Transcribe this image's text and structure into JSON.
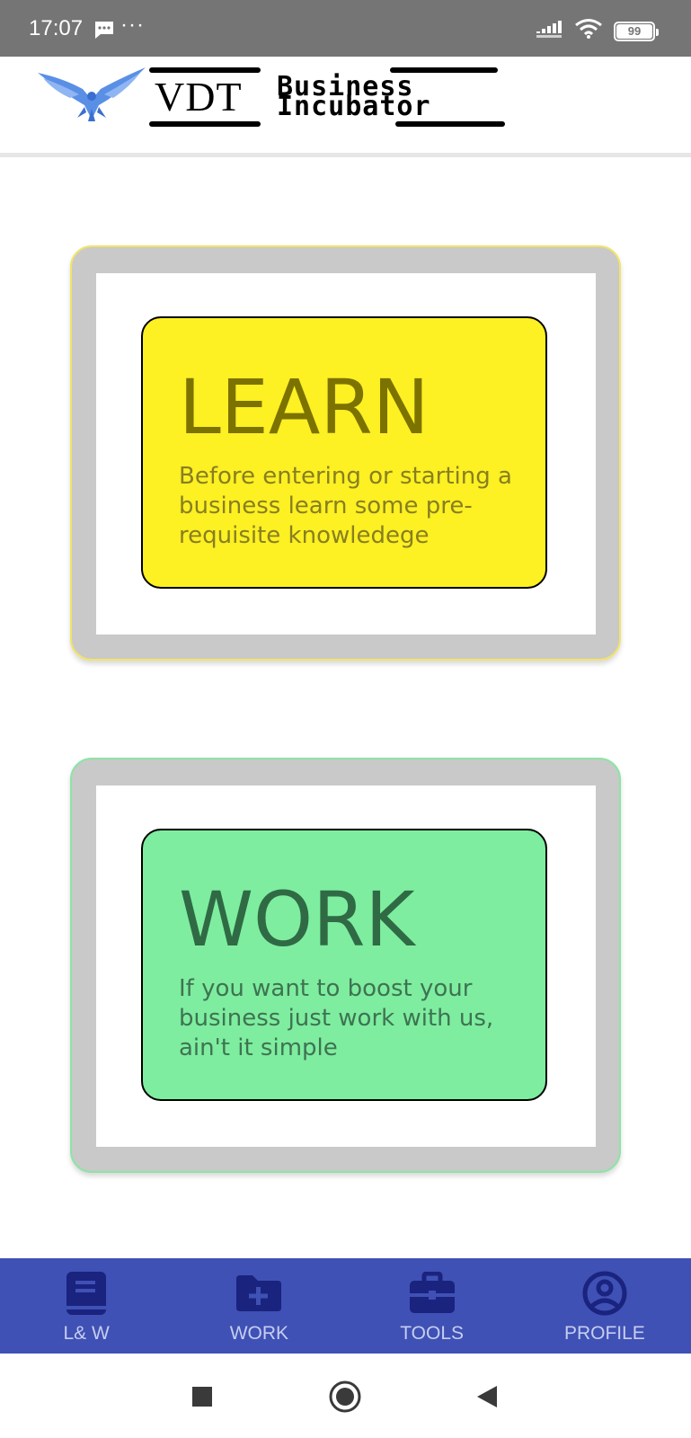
{
  "status_bar": {
    "time": "17:07",
    "dots": "···",
    "battery": "99",
    "battery_fraction": 0.99
  },
  "header": {
    "logo_vdt": "VDT",
    "logo_line1": "Business",
    "logo_line2": "Incubator"
  },
  "cards": {
    "learn": {
      "title": "LEARN",
      "desc": "Before entering or starting a business learn some pre-requisite knowledege",
      "color": "#fdf023"
    },
    "work": {
      "title": "WORK",
      "desc": "If you want to boost your business just work with us, ain't it simple",
      "color": "#7eed9f"
    }
  },
  "bottom_nav": {
    "color": "#3f51b5",
    "items": [
      {
        "label": "L& W",
        "icon": "book-icon"
      },
      {
        "label": "WORK",
        "icon": "folder-add-icon"
      },
      {
        "label": "TOOLS",
        "icon": "briefcase-icon"
      },
      {
        "label": "PROFILE",
        "icon": "profile-icon"
      }
    ]
  },
  "system_nav": {
    "items": [
      "recents-square-icon",
      "home-circle-icon",
      "back-triangle-icon"
    ]
  }
}
